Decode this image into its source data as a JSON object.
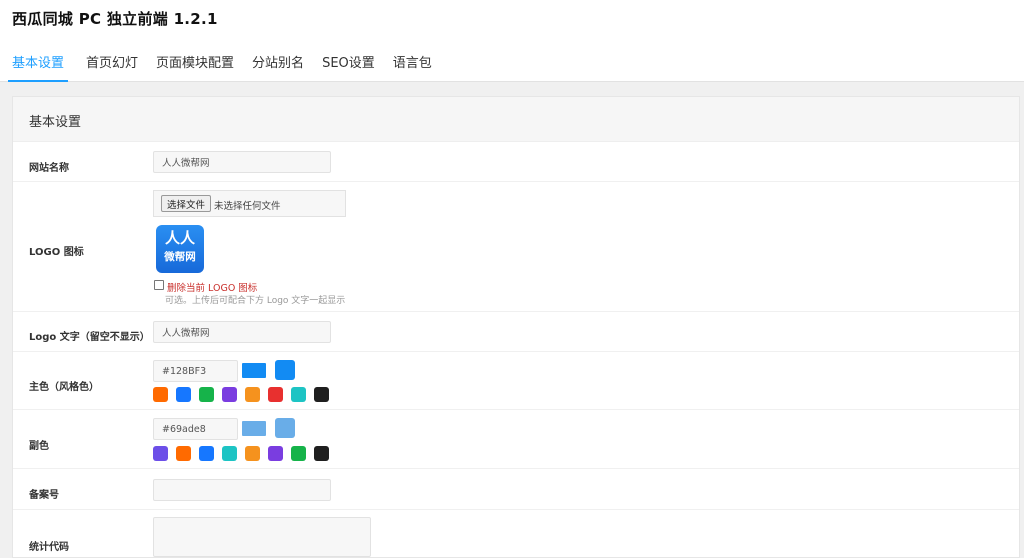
{
  "app": {
    "title": "西瓜同城 PC 独立前端 1.2.1"
  },
  "tabs": [
    {
      "label": "基本设置",
      "active": true
    },
    {
      "label": "首页幻灯"
    },
    {
      "label": "页面模块配置"
    },
    {
      "label": "分站别名"
    },
    {
      "label": "SEO设置"
    },
    {
      "label": "语言包"
    }
  ],
  "section": {
    "title": "基本设置"
  },
  "form": {
    "site_name": {
      "label": "网站名称",
      "value": "人人微帮网"
    },
    "logo": {
      "label": "LOGO 图标",
      "file_button": "选择文件",
      "file_status": "未选择任何文件",
      "preview_line1": "人人",
      "preview_line2": "微帮网",
      "delete_label": "删除当前 LOGO 图标",
      "help": "可选。上传后可配合下方 Logo 文字一起显示"
    },
    "logo_text": {
      "label": "Logo 文字（留空不显示）",
      "value": "人人微帮网"
    },
    "primary_color": {
      "label": "主色（风格色）",
      "value": "#128BF3",
      "swatch": "#128bf3",
      "presets": [
        "#ff6a00",
        "#1677ff",
        "#16b34a",
        "#7a3de0",
        "#f5921e",
        "#e8302f",
        "#1dc4c4",
        "#1f1f1f"
      ]
    },
    "secondary_color": {
      "label": "副色",
      "value": "#69ade8",
      "swatch": "#69ade8",
      "presets": [
        "#6c4fe8",
        "#ff6a00",
        "#1677ff",
        "#1dc4c4",
        "#f5921e",
        "#7a3de0",
        "#16b34a",
        "#1f1f1f"
      ]
    },
    "icp": {
      "label": "备案号",
      "value": ""
    },
    "stats_code": {
      "label": "统计代码",
      "value": ""
    }
  }
}
